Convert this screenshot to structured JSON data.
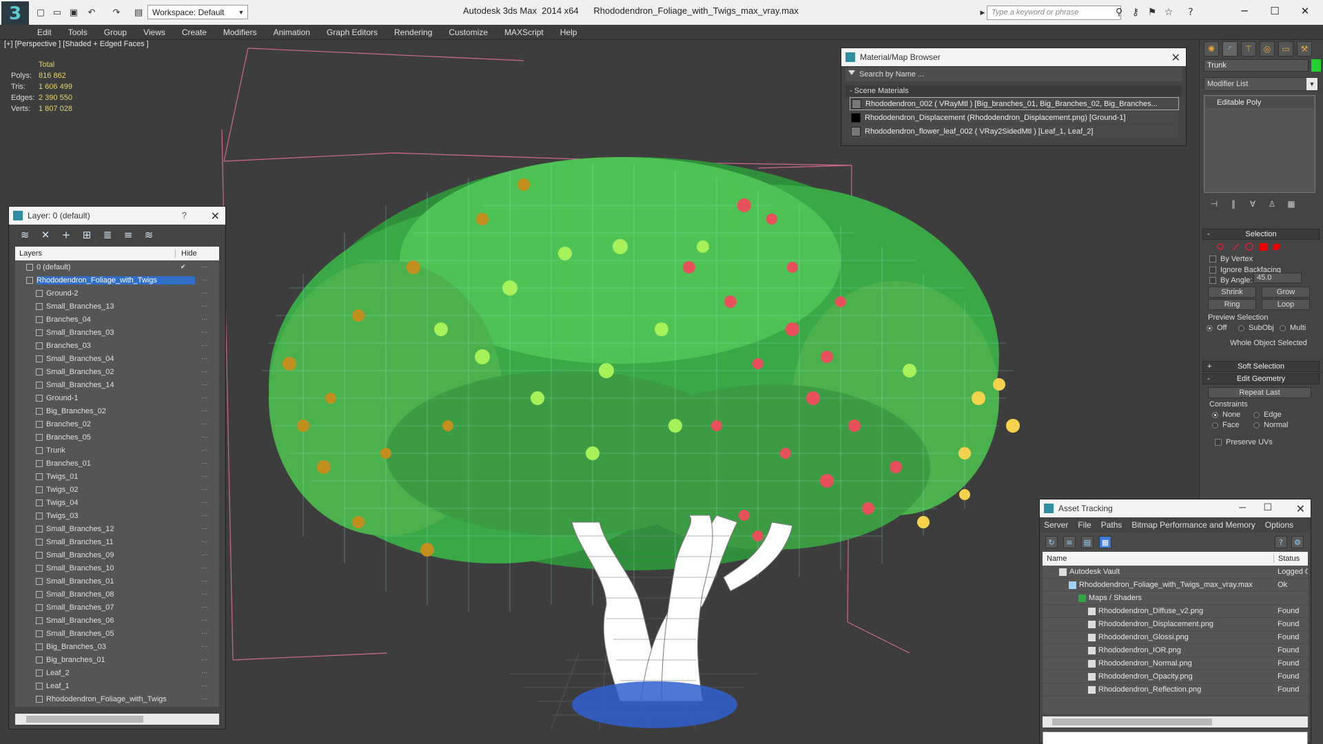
{
  "titlebar": {
    "app_name": "Autodesk 3ds Max  2014 x64",
    "file_name": "Rhododendron_Foliage_with_Twigs_max_vray.max",
    "workspace": "Workspace: Default",
    "search_placeholder": "Type a keyword or phrase",
    "logo_glyph": "3"
  },
  "menu": [
    "Edit",
    "Tools",
    "Group",
    "Views",
    "Create",
    "Modifiers",
    "Animation",
    "Graph Editors",
    "Rendering",
    "Customize",
    "MAXScript",
    "Help"
  ],
  "viewport": {
    "label": "[+] [Perspective ] [Shaded + Edged Faces ]",
    "stats_header": "Total",
    "stats": [
      {
        "key": "Polys:",
        "value": "816 862"
      },
      {
        "key": "Tris:",
        "value": "1 606 499"
      },
      {
        "key": "Edges:",
        "value": "2 390 550"
      },
      {
        "key": "Verts:",
        "value": "1 807 028"
      }
    ]
  },
  "layer_window": {
    "title": "Layer: 0 (default)",
    "help": "?",
    "col_layers": "Layers",
    "col_hide": "Hide",
    "rows": [
      {
        "name": "0 (default)",
        "level": 0,
        "checked": true
      },
      {
        "name": "Rhododendron_Foliage_with_Twigs",
        "level": 0,
        "selected": true
      },
      {
        "name": "Ground-2",
        "level": 1
      },
      {
        "name": "Small_Branches_13",
        "level": 1
      },
      {
        "name": "Branches_04",
        "level": 1
      },
      {
        "name": "Small_Branches_03",
        "level": 1
      },
      {
        "name": "Branches_03",
        "level": 1
      },
      {
        "name": "Small_Branches_04",
        "level": 1
      },
      {
        "name": "Small_Branches_02",
        "level": 1
      },
      {
        "name": "Small_Branches_14",
        "level": 1
      },
      {
        "name": "Ground-1",
        "level": 1
      },
      {
        "name": "Big_Branches_02",
        "level": 1
      },
      {
        "name": "Branches_02",
        "level": 1
      },
      {
        "name": "Branches_05",
        "level": 1
      },
      {
        "name": "Trunk",
        "level": 1
      },
      {
        "name": "Branches_01",
        "level": 1
      },
      {
        "name": "Twigs_01",
        "level": 1
      },
      {
        "name": "Twigs_02",
        "level": 1
      },
      {
        "name": "Twigs_04",
        "level": 1
      },
      {
        "name": "Twigs_03",
        "level": 1
      },
      {
        "name": "Small_Branches_12",
        "level": 1
      },
      {
        "name": "Small_Branches_11",
        "level": 1
      },
      {
        "name": "Small_Branches_09",
        "level": 1
      },
      {
        "name": "Small_Branches_10",
        "level": 1
      },
      {
        "name": "Small_Branches_01",
        "level": 1
      },
      {
        "name": "Small_Branches_08",
        "level": 1
      },
      {
        "name": "Small_Branches_07",
        "level": 1
      },
      {
        "name": "Small_Branches_06",
        "level": 1
      },
      {
        "name": "Small_Branches_05",
        "level": 1
      },
      {
        "name": "Big_Branches_03",
        "level": 1
      },
      {
        "name": "Big_branches_01",
        "level": 1
      },
      {
        "name": "Leaf_2",
        "level": 1
      },
      {
        "name": "Leaf_1",
        "level": 1
      },
      {
        "name": "Rhododendron_Foliage_with_Twigs",
        "level": 1
      }
    ]
  },
  "material_browser": {
    "title": "Material/Map Browser",
    "search_placeholder": "Search by Name ...",
    "section": "- Scene Materials",
    "items": [
      {
        "text": "Rhododendron_002  ( VRayMtl ) [Big_branches_01, Big_Branches_02, Big_Branches...",
        "swatch": "gray"
      },
      {
        "text": "Rhododendron_Displacement (Rhododendron_Displacement.png) [Ground-1]",
        "swatch": "black"
      },
      {
        "text": "Rhododendron_flower_leaf_002  ( VRay2SidedMtl ) [Leaf_1, Leaf_2]",
        "swatch": "gray"
      }
    ]
  },
  "asset_tracking": {
    "title": "Asset Tracking",
    "menu": [
      "Server",
      "File",
      "Paths",
      "Bitmap Performance and Memory",
      "Options"
    ],
    "col_name": "Name",
    "col_status": "Status",
    "rows": [
      {
        "name": "Autodesk Vault",
        "status": "Logged O",
        "level": 1
      },
      {
        "name": "Rhododendron_Foliage_with_Twigs_max_vray.max",
        "status": "Ok",
        "level": 2
      },
      {
        "name": "Maps / Shaders",
        "status": "",
        "level": 3
      },
      {
        "name": "Rhododendron_Diffuse_v2.png",
        "status": "Found",
        "level": 4
      },
      {
        "name": "Rhododendron_Displacement.png",
        "status": "Found",
        "level": 4
      },
      {
        "name": "Rhododendron_Glossi.png",
        "status": "Found",
        "level": 4
      },
      {
        "name": "Rhododendron_IOR.png",
        "status": "Found",
        "level": 4
      },
      {
        "name": "Rhododendron_Normal.png",
        "status": "Found",
        "level": 4
      },
      {
        "name": "Rhododendron_Opacity.png",
        "status": "Found",
        "level": 4
      },
      {
        "name": "Rhododendron_Reflection.png",
        "status": "Found",
        "level": 4
      }
    ]
  },
  "command_panel": {
    "object_name": "Trunk",
    "object_color": "#1fd12a",
    "modifier_list": "Modifier List",
    "stack_item": "Editable Poly",
    "selection": {
      "title": "Selection",
      "by_vertex": "By Vertex",
      "ignore_backfacing": "Ignore Backfacing",
      "by_angle": "By Angle:",
      "angle_value": "45.0",
      "shrink": "Shrink",
      "grow": "Grow",
      "ring": "Ring",
      "loop": "Loop",
      "preview_selection": "Preview Selection",
      "preview_off": "Off",
      "preview_subobj": "SubObj",
      "preview_multi": "Multi",
      "status": "Whole Object Selected"
    },
    "soft_selection": "Soft Selection",
    "edit_geometry": "Edit Geometry",
    "repeat_last": "Repeat Last",
    "constraints": "Constraints",
    "c_none": "None",
    "c_edge": "Edge",
    "c_face": "Face",
    "c_normal": "Normal",
    "preserve_uvs": "Preserve UVs"
  },
  "colors": {
    "accent_blue": "#2f6fc9",
    "stat_yellow": "#e6d36a",
    "foliage_green": "#3fb64a",
    "flower_red": "#e8505b",
    "wire_cyan": "#8ff2e6"
  }
}
